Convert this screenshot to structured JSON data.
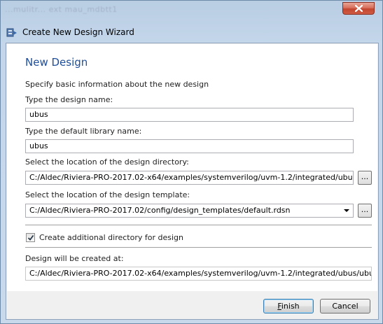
{
  "window": {
    "title": "Create New Design Wizard",
    "ghost_text": "...mulitr...  ext  mau_mdbtt1"
  },
  "page": {
    "heading": "New Design",
    "intro": "Specify basic information about the new design"
  },
  "design_name": {
    "label": "Type the design name:",
    "value": "ubus"
  },
  "library_name": {
    "label": "Type the default library name:",
    "value": "ubus"
  },
  "design_directory": {
    "label": "Select the location of the design directory:",
    "value": "C:/Aldec/Riviera-PRO-2017.02-x64/examples/systemverilog/uvm-1.2/integrated/ubus",
    "browse_label": "..."
  },
  "design_template": {
    "label": "Select the location of the design template:",
    "value": "C:/Aldec/Riviera-PRO-2017.02/config/design_templates/default.rdsn",
    "browse_label": "..."
  },
  "additional_directory": {
    "label": "Create additional directory for design",
    "checked": true
  },
  "created_at": {
    "label": "Design will be created at:",
    "value": "C:/Aldec/Riviera-PRO-2017.02-x64/examples/systemverilog/uvm-1.2/integrated/ubus/ubus"
  },
  "buttons": {
    "finish_mnemonic": "F",
    "finish_rest": "inish",
    "cancel": "Cancel"
  },
  "colors": {
    "heading": "#1f4e99",
    "close_button": "#c3462f",
    "default_button_border": "#3c7fb1"
  }
}
